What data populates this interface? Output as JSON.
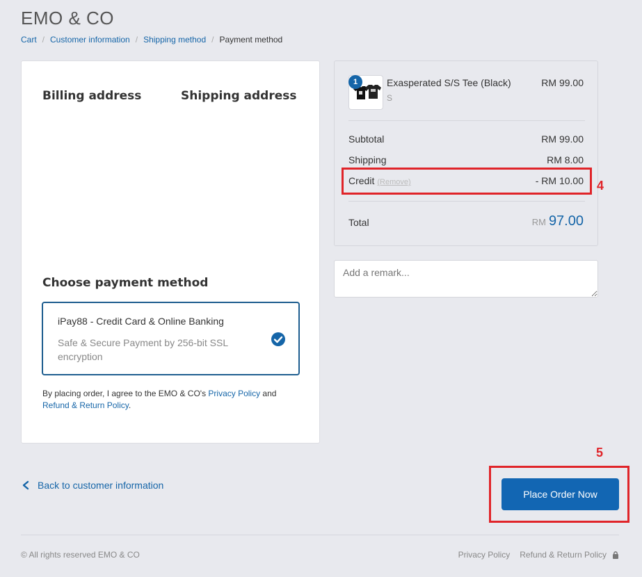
{
  "header": {
    "store_name": "EMO & CO"
  },
  "breadcrumb": {
    "items": [
      "Cart",
      "Customer information",
      "Shipping method"
    ],
    "current": "Payment method"
  },
  "checkout": {
    "billing_heading": "Billing address",
    "shipping_heading": "Shipping address",
    "payment_heading": "Choose payment method",
    "payment_option": {
      "title": "iPay88 - Credit Card & Online Banking",
      "description": "Safe & Secure Payment by 256-bit SSL encryption",
      "selected": true
    },
    "agreement": {
      "prefix": "By placing order, I agree to the EMO & CO's ",
      "privacy_link": "Privacy Policy",
      "middle": " and",
      "refund_link": "Refund & Return Policy",
      "suffix": "."
    }
  },
  "summary": {
    "product": {
      "quantity": "1",
      "name": "Exasperated S/S Tee (Black)",
      "variant": "S",
      "price": "RM 99.00"
    },
    "subtotal_label": "Subtotal",
    "subtotal_value": "RM 99.00",
    "shipping_label": "Shipping",
    "shipping_value": "RM 8.00",
    "credit_label": "Credit",
    "credit_remove": "(Remove)",
    "credit_value": "- RM 10.00",
    "total_label": "Total",
    "total_currency": "RM",
    "total_value": "97.00"
  },
  "remark": {
    "placeholder": "Add a remark..."
  },
  "actions": {
    "back_label": "Back to customer information",
    "place_order_label": "Place Order Now"
  },
  "annotations": {
    "marker_4": "4",
    "marker_5": "5"
  },
  "footer": {
    "copyright": "© All rights reserved EMO & CO",
    "privacy": "Privacy Policy",
    "refund": "Refund & Return Policy"
  },
  "colors": {
    "accent": "#1565a8",
    "annotation": "#e02429",
    "background": "#e8e9ee"
  }
}
